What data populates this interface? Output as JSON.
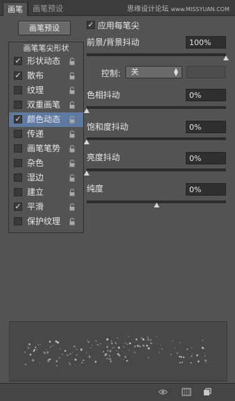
{
  "tabs": [
    "画笔",
    "画笔预设"
  ],
  "watermark": {
    "main": "思缘设计论坛",
    "url": "www.MISSYUAN.COM"
  },
  "preset_button": "画笔预设",
  "list": {
    "header": "画笔笔尖形状",
    "items": [
      {
        "label": "形状动态",
        "checked": true,
        "selected": false
      },
      {
        "label": "散布",
        "checked": true,
        "selected": false
      },
      {
        "label": "纹理",
        "checked": false,
        "selected": false
      },
      {
        "label": "双重画笔",
        "checked": false,
        "selected": false
      },
      {
        "label": "颜色动态",
        "checked": true,
        "selected": true
      },
      {
        "label": "传递",
        "checked": false,
        "selected": false
      },
      {
        "label": "画笔笔势",
        "checked": false,
        "selected": false
      },
      {
        "label": "杂色",
        "checked": false,
        "selected": false
      },
      {
        "label": "湿边",
        "checked": false,
        "selected": false
      },
      {
        "label": "建立",
        "checked": false,
        "selected": false
      },
      {
        "label": "平滑",
        "checked": true,
        "selected": false
      },
      {
        "label": "保护纹理",
        "checked": false,
        "selected": false
      }
    ]
  },
  "apply_per_tip": {
    "label": "应用每笔尖",
    "checked": true
  },
  "fg_bg_jitter": {
    "label": "前景/背景抖动",
    "value": "100%",
    "level": 1.0
  },
  "control": {
    "label": "控制:",
    "value": "关"
  },
  "hue_jitter": {
    "label": "色相抖动",
    "value": "0%",
    "level": 0.0
  },
  "saturation_jitter": {
    "label": "饱和度抖动",
    "value": "0%",
    "level": 0.0
  },
  "brightness_jitter": {
    "label": "亮度抖动",
    "value": "0%",
    "level": 0.0
  },
  "purity": {
    "label": "纯度",
    "value": "0%",
    "level": 0.5
  },
  "bottom_icons": [
    "eye-icon",
    "grid-icon",
    "new-brush-icon"
  ]
}
